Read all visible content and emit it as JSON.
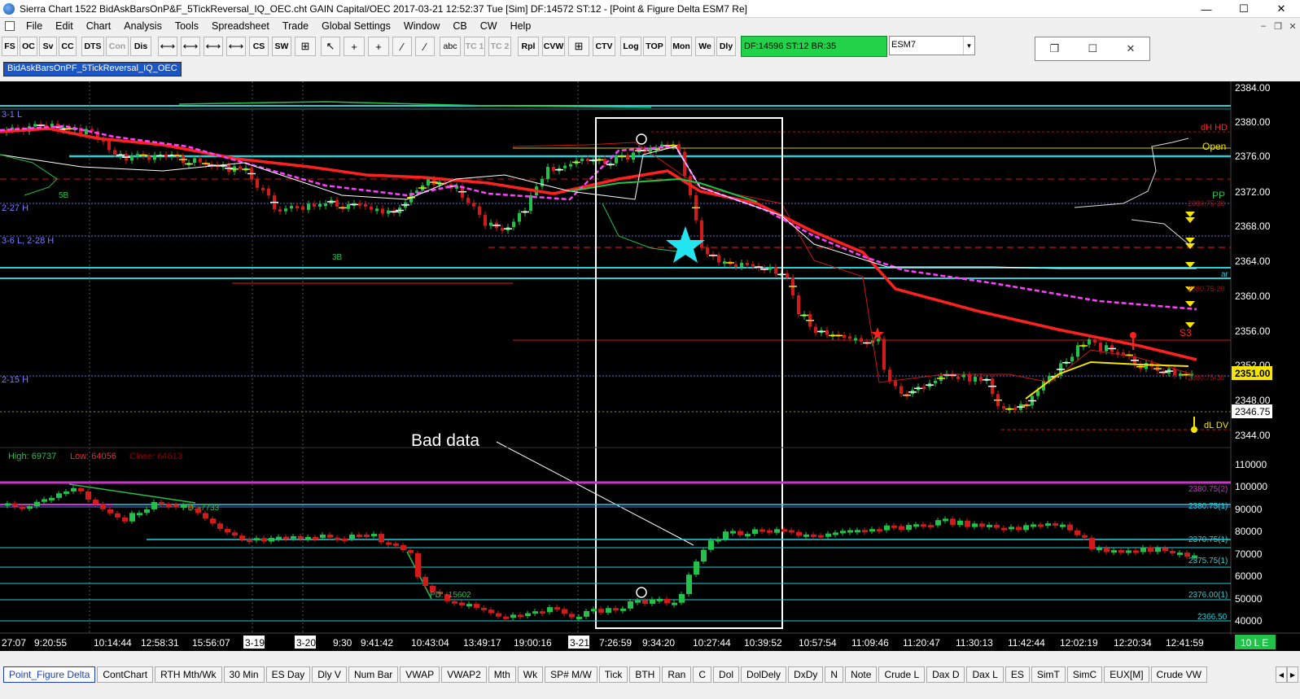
{
  "window": {
    "title": "Sierra Chart 1522 BidAskBarsOnP&F_5TickReversal_IQ_OEC.cht  GAIN Capital/OEC 2017-03-21  12:52:37 Tue [Sim]  DF:14572  ST:12 - [Point & Figure Delta  ESM7  Re]",
    "minimize": "—",
    "maximize": "☐",
    "close": "✕"
  },
  "menu": [
    "File",
    "Edit",
    "Chart",
    "Analysis",
    "Tools",
    "Spreadsheet",
    "Trade",
    "Global Settings",
    "Window",
    "CB",
    "CW",
    "Help"
  ],
  "toolbar": {
    "buttons": [
      "FS",
      "OC",
      "Sv",
      "CC",
      "DTS",
      "Con",
      "Dis",
      "⟷",
      "⟷",
      "⟷",
      "⟷",
      "CS",
      "SW",
      "⊞",
      "↖",
      "+",
      "+",
      "⁄",
      "⁄",
      "abc",
      "TC 1",
      "TC 2",
      "Rpl",
      "CVW",
      "⊞",
      "CTV",
      "Log",
      "TOP",
      "Mon",
      "We",
      "Dly"
    ],
    "status": "DF:14596  ST:12  BR:35",
    "symbol": "ESM7"
  },
  "chart_tab": "BidAskBarsOnPF_5TickReversal_IQ_OEC",
  "chart": {
    "price_labels": [
      "2384.00",
      "2380.00",
      "2376.00",
      "2372.00",
      "2368.00",
      "2364.00",
      "2360.00",
      "2356.00",
      "2352.00",
      "2348.00",
      "2344.00"
    ],
    "current_price": "2351.00",
    "last_price": "2346.75",
    "level_labels": {
      "dh": "dH HD",
      "open": "Open",
      "pp": "PP",
      "s3": "S3",
      "dl": "dL DV",
      "r1": "2380.75-30",
      "r2": "2380.75-20",
      "r3": "2380.75-30",
      "ar": "ar"
    },
    "left_labels": [
      "3-1 L",
      "2-27 H",
      "3-6 L, 2-28 H",
      "2-15 H"
    ],
    "small_labels": [
      "5B",
      "3B"
    ],
    "annotation": "Bad data",
    "delta_header": {
      "high": "High: 69737",
      "low": "Low: 64056",
      "close": "Close: 64613"
    },
    "delta_axis": [
      "110000",
      "100000",
      "90000",
      "80000",
      "70000",
      "60000",
      "50000",
      "40000"
    ],
    "delta_levels": [
      "2380.75(2)",
      "2380.75(1)",
      "2370.75(1)",
      "2375.75(1)",
      "2376.00(1)",
      "2366.50"
    ],
    "pd_labels": [
      "PD: -7733",
      "PD: -15602"
    ],
    "time_labels": [
      "27:07",
      "9:20:55",
      "10:14:44",
      "12:58:31",
      "15:56:07",
      "3-19",
      "3-20",
      "9:30",
      "9:41:42",
      "10:43:04",
      "13:49:17",
      "19:00:16",
      "3-21",
      "7:26:59",
      "9:34:20",
      "10:27:44",
      "10:39:52",
      "10:57:54",
      "11:09:46",
      "11:20:47",
      "11:30:13",
      "11:42:44",
      "12:02:19",
      "12:20:34",
      "12:41:59"
    ],
    "corner_label": "10 L E",
    "colors": {
      "background": "#000000",
      "up": "#22c24a",
      "down": "#d11a1a",
      "ma_red": "#ff2020",
      "ma_magenta": "#ff40ff",
      "cyan": "#22d0d8",
      "yellow": "#f5e500"
    }
  },
  "bottom_tabs": [
    "Point_Figure Delta",
    "ContChart",
    "RTH Mth/Wk",
    "30 Min",
    "ES Day",
    "Dly V",
    "Num Bar",
    "VWAP",
    "VWAP2",
    "Mth",
    "Wk",
    "SP# M/W",
    "Tick",
    "BTH",
    "Ran",
    "C",
    "Dol",
    "DolDely",
    "DxDy",
    "N",
    "Note",
    "Crude L",
    "Dax D",
    "Dax L",
    "ES",
    "SimT",
    "SimC",
    "EUX[M]",
    "Crude VW"
  ]
}
